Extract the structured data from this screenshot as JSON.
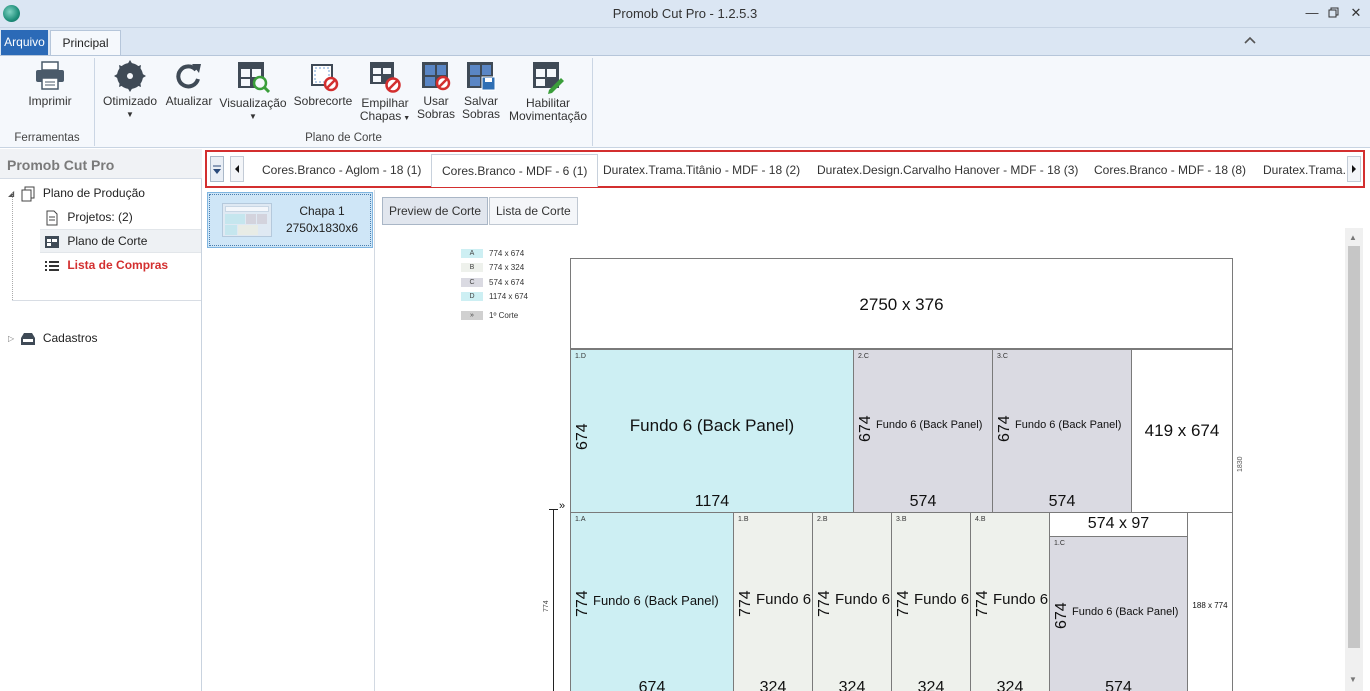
{
  "app": {
    "title": "Promob Cut Pro - 1.2.5.3",
    "window_controls": [
      "minimize-icon",
      "restore-icon",
      "close-icon"
    ]
  },
  "ribbon": {
    "tabs": {
      "arquivo": "Arquivo",
      "principal": "Principal"
    },
    "buttons": {
      "imprimir": "Imprimir",
      "otimizado": "Otimizado",
      "atualizar": "Atualizar",
      "visualizacao": "Visualização",
      "sobrecorte": "Sobrecorte",
      "empilhar_1": "Empilhar",
      "empilhar_2": "Chapas",
      "usar_1": "Usar",
      "usar_2": "Sobras",
      "salvar_1": "Salvar",
      "salvar_2": "Sobras",
      "habilitar_1": "Habilitar",
      "habilitar_2": "Movimentação"
    },
    "groups": {
      "ferramentas": "Ferramentas",
      "plano_de_corte": "Plano de Corte"
    }
  },
  "left_panel": {
    "header": "Promob Cut Pro",
    "tree": {
      "plano_producao": "Plano de Produção",
      "projetos": "Projetos: (2)",
      "plano_corte": "Plano de Corte",
      "lista_compras": "Lista de Compras",
      "cadastros": "Cadastros"
    }
  },
  "sheet_tabs": [
    "Cores.Branco - Aglom - 18 (1)",
    "Cores.Branco - MDF - 6 (1)",
    "Duratex.Trama.Titânio - MDF - 18 (2)",
    "Duratex.Design.Carvalho Hanover - MDF - 18 (3)",
    "Cores.Branco - MDF - 18 (8)",
    "Duratex.Trama.T"
  ],
  "sheet_list": {
    "name": "Chapa 1",
    "dims": "2750x1830x6"
  },
  "main": {
    "preview_button": "Preview de Corte",
    "list_button": "Lista de Corte",
    "legend": [
      {
        "key": "A",
        "label": "774 x 674",
        "color": "#cdeff3"
      },
      {
        "key": "B",
        "label": "774 x 324",
        "color": "#eef1ec"
      },
      {
        "key": "C",
        "label": "574 x 674",
        "color": "#dadae2"
      },
      {
        "key": "D",
        "label": "1174 x 674",
        "color": "#cdeff3"
      },
      {
        "key": "»",
        "label": "1º Corte",
        "color": "#d0d0d0"
      }
    ],
    "diagram": {
      "sheet_height": "1830",
      "first_strip_height": "774",
      "first_cut_marker": "»",
      "top_scrap": "2750 x 376",
      "row1": {
        "d1": {
          "id": "1.D",
          "name": "Fundo 6 (Back Panel)",
          "h": "674",
          "w": "1174"
        },
        "c2": {
          "id": "2.C",
          "name": "Fundo 6 (Back Panel)",
          "h": "674",
          "w": "574"
        },
        "c3": {
          "id": "3.C",
          "name": "Fundo 6 (Back Panel)",
          "h": "674",
          "w": "574"
        },
        "scrap": "419 x 674"
      },
      "row2": {
        "a1": {
          "id": "1.A",
          "name": "Fundo 6 (Back Panel)",
          "h": "774",
          "w": "674"
        },
        "b1": {
          "id": "1.B",
          "name": "Fundo 6",
          "h": "774",
          "w": "324"
        },
        "b2": {
          "id": "2.B",
          "name": "Fundo 6",
          "h": "774",
          "w": "324"
        },
        "b3": {
          "id": "3.B",
          "name": "Fundo 6",
          "h": "774",
          "w": "324"
        },
        "b4": {
          "id": "4.B",
          "name": "Fundo 6",
          "h": "774",
          "w": "324"
        },
        "scrap_top": "574 x 97",
        "c1": {
          "id": "1.C",
          "name": "Fundo 6 (Back Panel)",
          "h": "674",
          "w": "574"
        },
        "scrap_right": "188 x 774"
      }
    }
  }
}
